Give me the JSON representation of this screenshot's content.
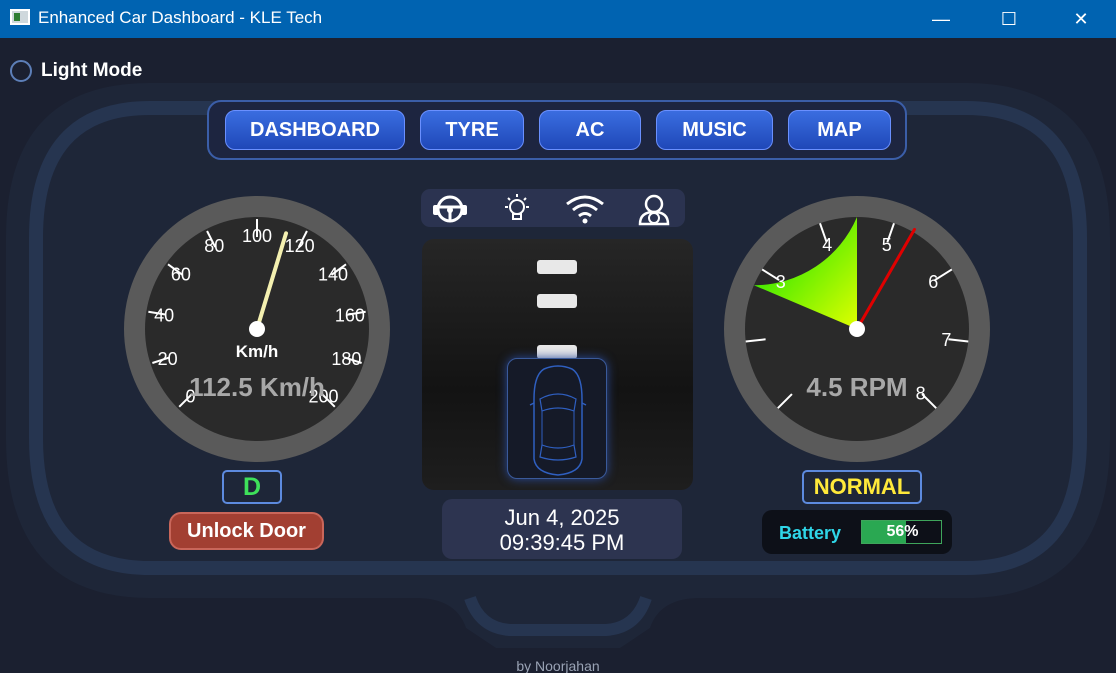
{
  "window": {
    "title": "Enhanced Car Dashboard - KLE Tech",
    "min_icon": "—",
    "max_icon": "☐",
    "close_icon": "✕"
  },
  "light_mode": {
    "label": "Light Mode",
    "checked": false
  },
  "nav": {
    "tabs": [
      "DASHBOARD",
      "TYRE",
      "AC",
      "MUSIC",
      "MAP"
    ]
  },
  "speedometer": {
    "ticks": [
      "0",
      "20",
      "40",
      "60",
      "80",
      "100",
      "120",
      "140",
      "160",
      "180",
      "200"
    ],
    "max": 200,
    "value": 112.5,
    "unit_label": "Km/h",
    "readout": "112.5 Km/h",
    "needle_color": "#f4f0b0"
  },
  "tachometer": {
    "ticks": [
      "",
      "",
      "3",
      "4",
      "5",
      "6",
      "7",
      "8"
    ],
    "min": 1,
    "max": 8,
    "value": 4.5,
    "readout": "4.5  RPM",
    "needle_color": "#e00000"
  },
  "status_icons": [
    "steering-wheel-icon",
    "light-bulb-icon",
    "wifi-icon",
    "driver-icon"
  ],
  "gear": "D",
  "door_button": "Unlock Door",
  "date": "Jun 4, 2025",
  "time": "09:39:45 PM",
  "drive_mode": "NORMAL",
  "battery": {
    "label": "Battery",
    "level": 0.56,
    "text": "56%"
  },
  "footer": "by Noorjahan",
  "colors": {
    "titlebar": "#0063b1",
    "accent": "#3a6de0",
    "background": "#1b2030"
  }
}
